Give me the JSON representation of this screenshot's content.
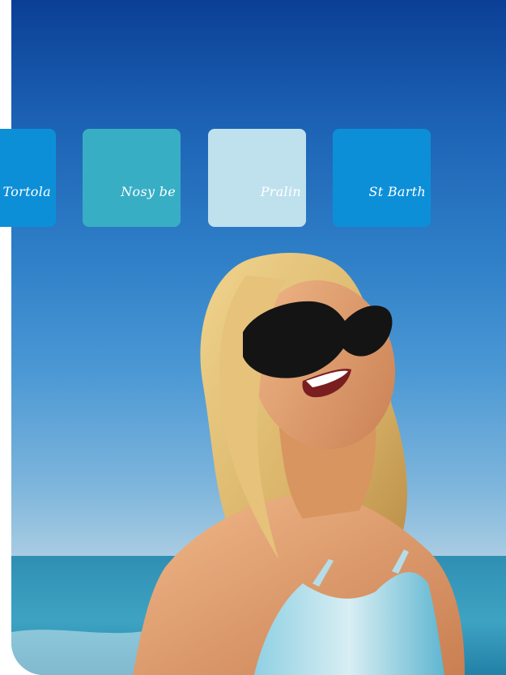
{
  "destinations": [
    {
      "label": "Tortola",
      "color": "#0d8fd8"
    },
    {
      "label": "Nosy be",
      "color": "#38aec5"
    },
    {
      "label": "Pralin",
      "color": "#bfe1ee"
    },
    {
      "label": "St Barth",
      "color": "#0d8fd8"
    }
  ],
  "colors": {
    "sky_top": "#0b3f95",
    "sky_bottom": "#b9d6e6",
    "sea": "#2a8fb5",
    "swimsuit": "#7fc6dc"
  }
}
